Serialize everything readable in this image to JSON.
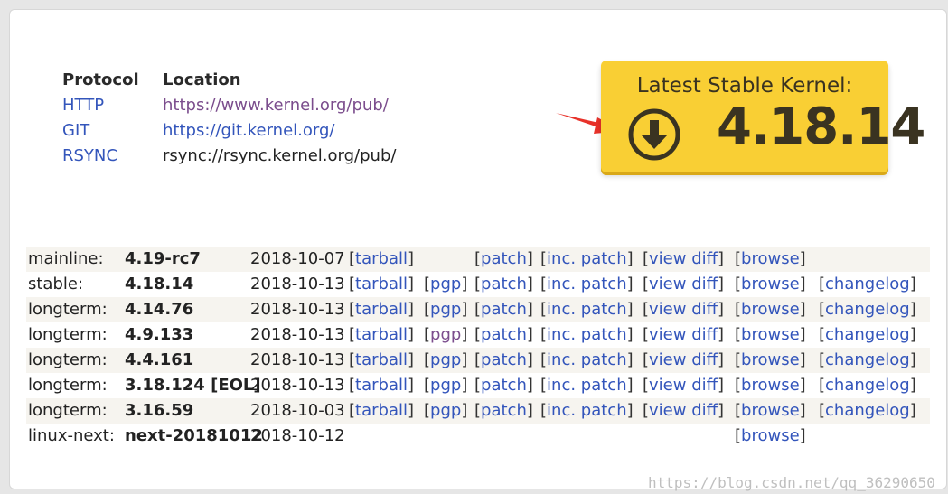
{
  "protocols": {
    "header": {
      "protocol": "Protocol",
      "location": "Location"
    },
    "rows": [
      {
        "name": "HTTP",
        "location": "https://www.kernel.org/pub/"
      },
      {
        "name": "GIT",
        "location": "https://git.kernel.org/"
      },
      {
        "name": "RSYNC",
        "location": "rsync://rsync.kernel.org/pub/"
      }
    ]
  },
  "banner": {
    "title": "Latest Stable Kernel:",
    "version": "4.18.14",
    "icon": "download-circle-icon",
    "bg_color": "#f9cf34"
  },
  "releases": [
    {
      "type": "mainline:",
      "version": "4.19-rc7",
      "date": "2018-10-07",
      "tarball": "tarball",
      "pgp": "",
      "patch": "patch",
      "inc_patch": "inc. patch",
      "view_diff": "view diff",
      "browse": "browse",
      "changelog": ""
    },
    {
      "type": "stable:",
      "version": "4.18.14",
      "date": "2018-10-13",
      "tarball": "tarball",
      "pgp": "pgp",
      "patch": "patch",
      "inc_patch": "inc. patch",
      "view_diff": "view diff",
      "browse": "browse",
      "changelog": "changelog"
    },
    {
      "type": "longterm:",
      "version": "4.14.76",
      "date": "2018-10-13",
      "tarball": "tarball",
      "pgp": "pgp",
      "patch": "patch",
      "inc_patch": "inc. patch",
      "view_diff": "view diff",
      "browse": "browse",
      "changelog": "changelog"
    },
    {
      "type": "longterm:",
      "version": "4.9.133",
      "date": "2018-10-13",
      "tarball": "tarball",
      "pgp": "pgp",
      "patch": "patch",
      "inc_patch": "inc. patch",
      "view_diff": "view diff",
      "browse": "browse",
      "changelog": "changelog"
    },
    {
      "type": "longterm:",
      "version": "4.4.161",
      "date": "2018-10-13",
      "tarball": "tarball",
      "pgp": "pgp",
      "patch": "patch",
      "inc_patch": "inc. patch",
      "view_diff": "view diff",
      "browse": "browse",
      "changelog": "changelog"
    },
    {
      "type": "longterm:",
      "version": "3.18.124 [EOL]",
      "date": "2018-10-13",
      "tarball": "tarball",
      "pgp": "pgp",
      "patch": "patch",
      "inc_patch": "inc. patch",
      "view_diff": "view diff",
      "browse": "browse",
      "changelog": "changelog"
    },
    {
      "type": "longterm:",
      "version": "3.16.59",
      "date": "2018-10-03",
      "tarball": "tarball",
      "pgp": "pgp",
      "patch": "patch",
      "inc_patch": "inc. patch",
      "view_diff": "view diff",
      "browse": "browse",
      "changelog": "changelog"
    },
    {
      "type": "linux-next:",
      "version": "next-20181012",
      "date": "2018-10-12",
      "tarball": "",
      "pgp": "",
      "patch": "",
      "inc_patch": "",
      "view_diff": "",
      "browse": "browse",
      "changelog": ""
    }
  ],
  "watermark": "https://blog.csdn.net/qq_36290650",
  "colors": {
    "link": "#3355bb",
    "visited": "#7b4d8d",
    "row_shade": "#f6f4ef",
    "arrow": "#e8322a"
  }
}
